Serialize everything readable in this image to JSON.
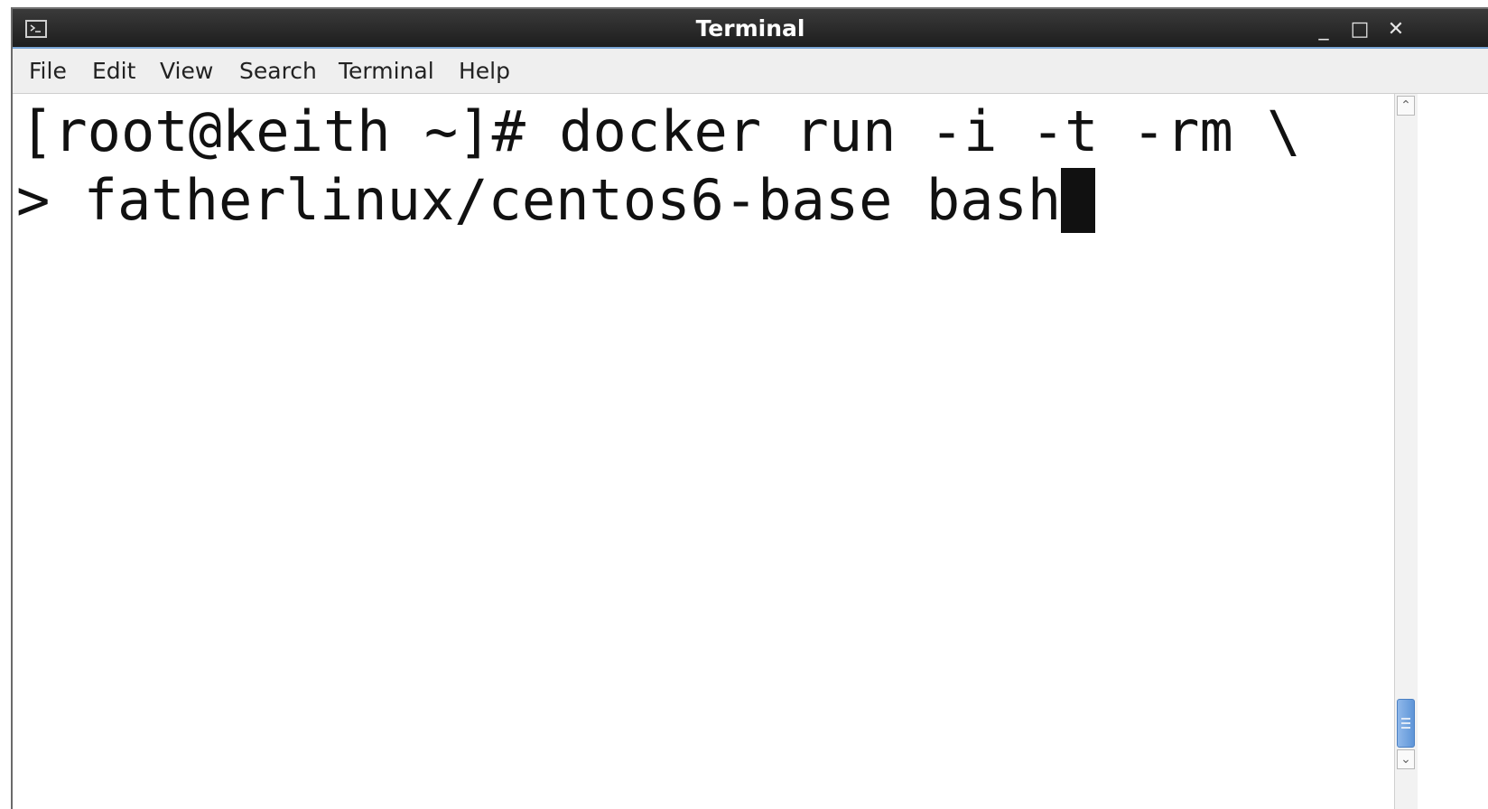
{
  "window": {
    "title": "Terminal",
    "controls": {
      "minimize": "_",
      "maximize": "□",
      "close": "✕"
    },
    "icon": "terminal-icon"
  },
  "menubar": {
    "items": [
      "File",
      "Edit",
      "View",
      "Search",
      "Terminal",
      "Help"
    ]
  },
  "terminal": {
    "lines": [
      "[root@keith ~]# docker run -i -t -rm \\",
      "> fatherlinux/centos6-base bash"
    ]
  },
  "scrollbar": {
    "up_arrow": "⌃",
    "down_arrow": "⌄"
  }
}
